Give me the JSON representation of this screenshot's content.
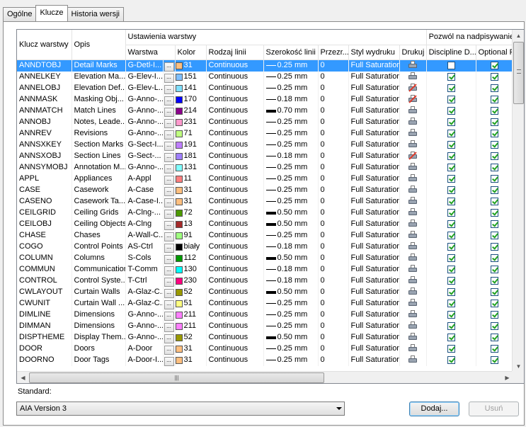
{
  "tabs": [
    {
      "label": "Ogólne",
      "active": false
    },
    {
      "label": "Klucze",
      "active": true
    },
    {
      "label": "Historia wersji",
      "active": false
    }
  ],
  "headers": {
    "group_layer": "Ustawienia warstwy",
    "group_override": "Pozwól na nadpisywanie",
    "key": "Klucz warstwy",
    "desc": "Opis",
    "layer": "Warstwa",
    "color": "Kolor",
    "linetype": "Rodzaj linii",
    "lineweight": "Szerokość linii",
    "transparency": "Przezr...",
    "plotstyle": "Styl wydruku",
    "plot": "Drukuj",
    "discipline": "Discipline D...",
    "optional": "Optional F..."
  },
  "colors": {
    "selected_row": "#3399ff"
  },
  "rows": [
    {
      "key": "ANNDTOBJ",
      "desc": "Detail Marks",
      "layer": "G-Detl-I...",
      "color": "31",
      "swatch": "#ffbf7f",
      "linetype": "Continuous",
      "lw": "0.25 mm",
      "lw_thick": false,
      "transp": "0",
      "style": "Full Saturation",
      "plot": true,
      "discipline": false,
      "optional": true,
      "selected": true
    },
    {
      "key": "ANNELKEY",
      "desc": "Elevation Ma...",
      "layer": "G-Elev-I...",
      "color": "151",
      "swatch": "#7fbfff",
      "linetype": "Continuous",
      "lw": "0.25 mm",
      "lw_thick": false,
      "transp": "0",
      "style": "Full Saturation",
      "plot": true,
      "discipline": true,
      "optional": true
    },
    {
      "key": "ANNELOBJ",
      "desc": "Elevation Def...",
      "layer": "G-Elev-L...",
      "color": "141",
      "swatch": "#7fdfff",
      "linetype": "Continuous",
      "lw": "0.25 mm",
      "lw_thick": false,
      "transp": "0",
      "style": "Full Saturation",
      "plot": false,
      "discipline": true,
      "optional": true
    },
    {
      "key": "ANNMASK",
      "desc": "Masking Obj...",
      "layer": "G-Anno-...",
      "color": "170",
      "swatch": "#0000ff",
      "linetype": "Continuous",
      "lw": "0.18 mm",
      "lw_thick": false,
      "transp": "0",
      "style": "Full Saturation",
      "plot": false,
      "discipline": true,
      "optional": true
    },
    {
      "key": "ANNMATCH",
      "desc": "Match Lines",
      "layer": "G-Anno-...",
      "color": "214",
      "swatch": "#8b008b",
      "linetype": "Continuous",
      "lw": "0.70 mm",
      "lw_thick": true,
      "transp": "0",
      "style": "Full Saturation",
      "plot": true,
      "discipline": true,
      "optional": true
    },
    {
      "key": "ANNOBJ",
      "desc": "Notes, Leade...",
      "layer": "G-Anno-...",
      "color": "231",
      "swatch": "#ff99cc",
      "linetype": "Continuous",
      "lw": "0.25 mm",
      "lw_thick": false,
      "transp": "0",
      "style": "Full Saturation",
      "plot": true,
      "discipline": true,
      "optional": true
    },
    {
      "key": "ANNREV",
      "desc": "Revisions",
      "layer": "G-Anno-...",
      "color": "71",
      "swatch": "#bfff7f",
      "linetype": "Continuous",
      "lw": "0.25 mm",
      "lw_thick": false,
      "transp": "0",
      "style": "Full Saturation",
      "plot": true,
      "discipline": true,
      "optional": true
    },
    {
      "key": "ANNSXKEY",
      "desc": "Section Marks",
      "layer": "G-Sect-I...",
      "color": "191",
      "swatch": "#bf7fff",
      "linetype": "Continuous",
      "lw": "0.25 mm",
      "lw_thick": false,
      "transp": "0",
      "style": "Full Saturation",
      "plot": true,
      "discipline": true,
      "optional": true
    },
    {
      "key": "ANNSXOBJ",
      "desc": "Section Lines",
      "layer": "G-Sect-...",
      "color": "181",
      "swatch": "#9f7fff",
      "linetype": "Continuous",
      "lw": "0.18 mm",
      "lw_thick": false,
      "transp": "0",
      "style": "Full Saturation",
      "plot": false,
      "discipline": true,
      "optional": true
    },
    {
      "key": "ANNSYMOBJ",
      "desc": "Annotation M...",
      "layer": "G-Anno-...",
      "color": "131",
      "swatch": "#7fffff",
      "linetype": "Continuous",
      "lw": "0.25 mm",
      "lw_thick": false,
      "transp": "0",
      "style": "Full Saturation",
      "plot": true,
      "discipline": true,
      "optional": true
    },
    {
      "key": "APPL",
      "desc": "Appliances",
      "layer": "A-Appl",
      "color": "11",
      "swatch": "#ff7f7f",
      "linetype": "Continuous",
      "lw": "0.25 mm",
      "lw_thick": false,
      "transp": "0",
      "style": "Full Saturation",
      "plot": true,
      "discipline": true,
      "optional": true
    },
    {
      "key": "CASE",
      "desc": "Casework",
      "layer": "A-Case",
      "color": "31",
      "swatch": "#ffbf7f",
      "linetype": "Continuous",
      "lw": "0.25 mm",
      "lw_thick": false,
      "transp": "0",
      "style": "Full Saturation",
      "plot": true,
      "discipline": true,
      "optional": true
    },
    {
      "key": "CASENO",
      "desc": "Casework Ta...",
      "layer": "A-Case-I...",
      "color": "31",
      "swatch": "#ffbf7f",
      "linetype": "Continuous",
      "lw": "0.25 mm",
      "lw_thick": false,
      "transp": "0",
      "style": "Full Saturation",
      "plot": true,
      "discipline": true,
      "optional": true
    },
    {
      "key": "CEILGRID",
      "desc": "Ceiling Grids",
      "layer": "A-Clng-...",
      "color": "72",
      "swatch": "#4c9900",
      "linetype": "Continuous",
      "lw": "0.50 mm",
      "lw_thick": true,
      "transp": "0",
      "style": "Full Saturation",
      "plot": true,
      "discipline": true,
      "optional": true
    },
    {
      "key": "CEILOBJ",
      "desc": "Ceiling Objects",
      "layer": "A-Clng",
      "color": "13",
      "swatch": "#a52a2a",
      "linetype": "Continuous",
      "lw": "0.50 mm",
      "lw_thick": true,
      "transp": "0",
      "style": "Full Saturation",
      "plot": true,
      "discipline": true,
      "optional": true
    },
    {
      "key": "CHASE",
      "desc": "Chases",
      "layer": "A-Wall-C...",
      "color": "91",
      "swatch": "#9fff7f",
      "linetype": "Continuous",
      "lw": "0.25 mm",
      "lw_thick": false,
      "transp": "0",
      "style": "Full Saturation",
      "plot": true,
      "discipline": true,
      "optional": true
    },
    {
      "key": "COGO",
      "desc": "Control Points",
      "layer": "AS-Ctrl",
      "color": "biały",
      "swatch": "#000000",
      "linetype": "Continuous",
      "lw": "0.18 mm",
      "lw_thick": false,
      "transp": "0",
      "style": "Full Saturation",
      "plot": true,
      "discipline": true,
      "optional": true
    },
    {
      "key": "COLUMN",
      "desc": "Columns",
      "layer": "S-Cols",
      "color": "112",
      "swatch": "#009900",
      "linetype": "Continuous",
      "lw": "0.50 mm",
      "lw_thick": true,
      "transp": "0",
      "style": "Full Saturation",
      "plot": true,
      "discipline": true,
      "optional": true
    },
    {
      "key": "COMMUN",
      "desc": "Communication",
      "layer": "T-Comm",
      "color": "130",
      "swatch": "#00ffff",
      "linetype": "Continuous",
      "lw": "0.18 mm",
      "lw_thick": false,
      "transp": "0",
      "style": "Full Saturation",
      "plot": true,
      "discipline": true,
      "optional": true
    },
    {
      "key": "CONTROL",
      "desc": "Control Syste...",
      "layer": "T-Ctrl",
      "color": "230",
      "swatch": "#ff0080",
      "linetype": "Continuous",
      "lw": "0.18 mm",
      "lw_thick": false,
      "transp": "0",
      "style": "Full Saturation",
      "plot": true,
      "discipline": true,
      "optional": true
    },
    {
      "key": "CWLAYOUT",
      "desc": "Curtain Walls",
      "layer": "A-Glaz-C...",
      "color": "52",
      "swatch": "#999900",
      "linetype": "Continuous",
      "lw": "0.50 mm",
      "lw_thick": true,
      "transp": "0",
      "style": "Full Saturation",
      "plot": true,
      "discipline": true,
      "optional": true
    },
    {
      "key": "CWUNIT",
      "desc": "Curtain Wall ...",
      "layer": "A-Glaz-C...",
      "color": "51",
      "swatch": "#ffff7f",
      "linetype": "Continuous",
      "lw": "0.25 mm",
      "lw_thick": false,
      "transp": "0",
      "style": "Full Saturation",
      "plot": true,
      "discipline": true,
      "optional": true
    },
    {
      "key": "DIMLINE",
      "desc": "Dimensions",
      "layer": "G-Anno-...",
      "color": "211",
      "swatch": "#ff7fff",
      "linetype": "Continuous",
      "lw": "0.25 mm",
      "lw_thick": false,
      "transp": "0",
      "style": "Full Saturation",
      "plot": true,
      "discipline": true,
      "optional": true
    },
    {
      "key": "DIMMAN",
      "desc": "Dimensions",
      "layer": "G-Anno-...",
      "color": "211",
      "swatch": "#ff7fff",
      "linetype": "Continuous",
      "lw": "0.25 mm",
      "lw_thick": false,
      "transp": "0",
      "style": "Full Saturation",
      "plot": true,
      "discipline": true,
      "optional": true
    },
    {
      "key": "DISPTHEME",
      "desc": "Display Them...",
      "layer": "G-Anno-...",
      "color": "52",
      "swatch": "#999900",
      "linetype": "Continuous",
      "lw": "0.50 mm",
      "lw_thick": true,
      "transp": "0",
      "style": "Full Saturation",
      "plot": true,
      "discipline": true,
      "optional": true
    },
    {
      "key": "DOOR",
      "desc": "Doors",
      "layer": "A-Door",
      "color": "31",
      "swatch": "#ffbf7f",
      "linetype": "Continuous",
      "lw": "0.25 mm",
      "lw_thick": false,
      "transp": "0",
      "style": "Full Saturation",
      "plot": true,
      "discipline": true,
      "optional": true
    },
    {
      "key": "DOORNO",
      "desc": "Door Tags",
      "layer": "A-Door-I...",
      "color": "31",
      "swatch": "#ffbf7f",
      "linetype": "Continuous",
      "lw": "0.25 mm",
      "lw_thick": false,
      "transp": "0",
      "style": "Full Saturation",
      "plot": true,
      "discipline": true,
      "optional": true
    }
  ],
  "standard": {
    "label": "Standard:",
    "value": "AIA Version 3"
  },
  "buttons": {
    "add": "Dodaj...",
    "remove": "Usuń"
  }
}
